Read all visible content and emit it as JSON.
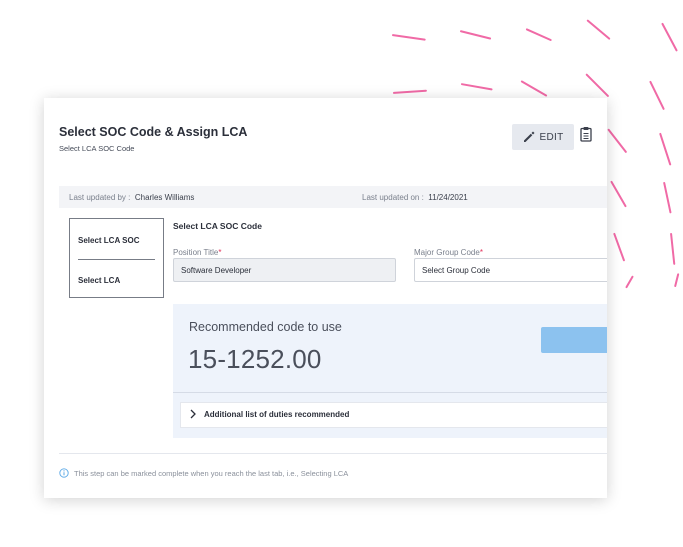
{
  "header": {
    "title": "Select SOC Code & Assign LCA",
    "subtitle": "Select LCA SOC Code",
    "edit_label": "EDIT"
  },
  "meta": {
    "updated_by_label": "Last updated by :",
    "updated_by_value": "Charles Williams",
    "updated_on_label": "Last updated on :",
    "updated_on_value": "11/24/2021"
  },
  "side_nav": {
    "items": [
      {
        "label": "Select LCA SOC"
      },
      {
        "label": "Select LCA"
      }
    ]
  },
  "form": {
    "section_title": "Select LCA SOC Code",
    "position_title_label": "Position Title",
    "position_title_value": "Software Developer",
    "major_group_label": "Major Group Code",
    "major_group_value": "Select Group Code",
    "required_mark": "*"
  },
  "recommendation": {
    "label": "Recommended code to use",
    "code": "15-1252.00",
    "duties_label": "Additional list of duties recommended"
  },
  "footer": {
    "note": "This step can be marked complete when you reach the last tab, i.e., Selecting LCA"
  },
  "colors": {
    "accent_dash": "#f06aa6",
    "panel_bg": "#eef3fb",
    "button_blue": "#8cc2ef",
    "required": "#e3325b"
  }
}
